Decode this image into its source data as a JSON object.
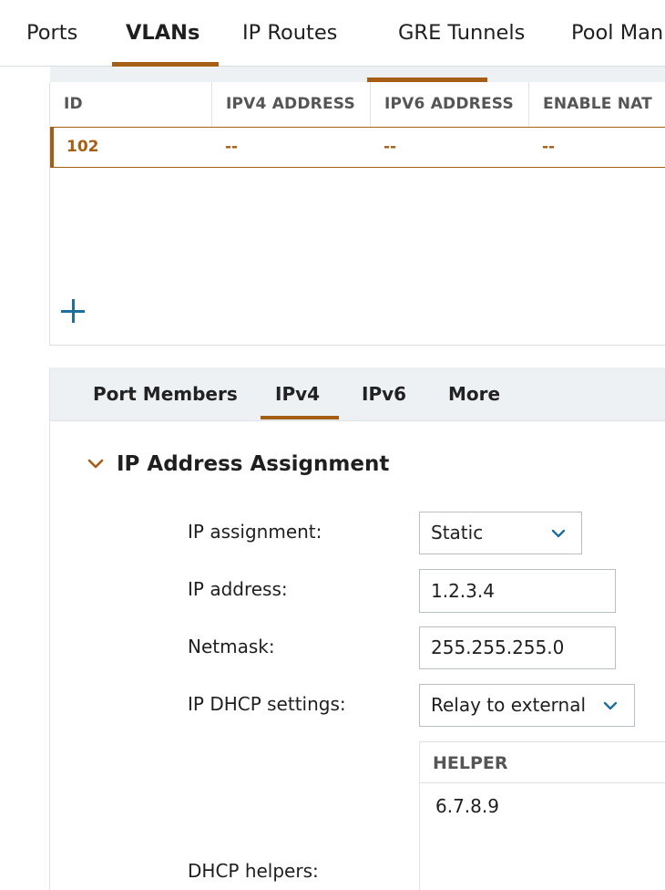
{
  "top_tabs": [
    {
      "label": "Ports"
    },
    {
      "label": "VLANs",
      "active": true
    },
    {
      "label": "IP Routes"
    },
    {
      "label": "GRE Tunnels"
    },
    {
      "label": "Pool Man"
    }
  ],
  "vlan_table": {
    "columns": [
      "ID",
      "IPV4 ADDRESS",
      "IPV6 ADDRESS",
      "ENABLE NAT"
    ],
    "rows": [
      {
        "id": "102",
        "ipv4": "--",
        "ipv6": "--",
        "nat": "--"
      }
    ]
  },
  "sub_tabs": [
    {
      "label": "Port Members"
    },
    {
      "label": "IPv4",
      "active": true
    },
    {
      "label": "IPv6"
    },
    {
      "label": "More"
    }
  ],
  "section": {
    "title": "IP Address Assignment"
  },
  "form": {
    "ip_assignment_label": "IP assignment:",
    "ip_assignment_value": "Static",
    "ip_address_label": "IP address:",
    "ip_address_value": "1.2.3.4",
    "netmask_label": "Netmask:",
    "netmask_value": "255.255.255.0",
    "dhcp_label": "IP DHCP settings:",
    "dhcp_value": "Relay to external",
    "helpers_label": "DHCP helpers:"
  },
  "helpers": {
    "column": "HELPER",
    "values": [
      "6.7.8.9"
    ]
  },
  "colors": {
    "accent": "#a65e15",
    "link": "#1f6f9c"
  }
}
